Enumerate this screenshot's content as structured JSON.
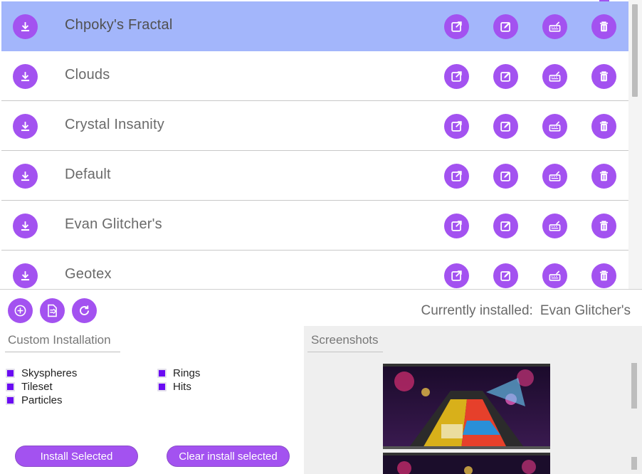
{
  "skins": [
    {
      "name": "Chpoky's Fractal",
      "selected": true
    },
    {
      "name": "Clouds",
      "selected": false
    },
    {
      "name": "Crystal Insanity",
      "selected": false
    },
    {
      "name": "Default",
      "selected": false
    },
    {
      "name": "Evan Glitcher's",
      "selected": false
    },
    {
      "name": "Geotex",
      "selected": false
    }
  ],
  "row_icons": {
    "install": "download-icon",
    "open": "open-external-icon",
    "edit": "edit-icon",
    "configure": "keyboard-edit-icon",
    "delete": "trash-icon"
  },
  "toolbar": {
    "add": "add-circle-icon",
    "import": "import-file-icon",
    "refresh": "refresh-icon"
  },
  "status": {
    "label": "Currently installed:",
    "value": "Evan Glitcher's"
  },
  "custom_installation": {
    "title": "Custom Installation",
    "options": [
      {
        "label": "Skyspheres",
        "checked": true
      },
      {
        "label": "Tileset",
        "checked": true
      },
      {
        "label": "Particles",
        "checked": true
      },
      {
        "label": "Rings",
        "checked": true
      },
      {
        "label": "Hits",
        "checked": true
      }
    ],
    "install_button": "Install Selected",
    "clear_button": "Clear install selected"
  },
  "screenshots": {
    "title": "Screenshots"
  },
  "colors": {
    "accent": "#a352f0",
    "selected_row": "#a3b6fb",
    "checkbox": "#6a0bf3"
  }
}
